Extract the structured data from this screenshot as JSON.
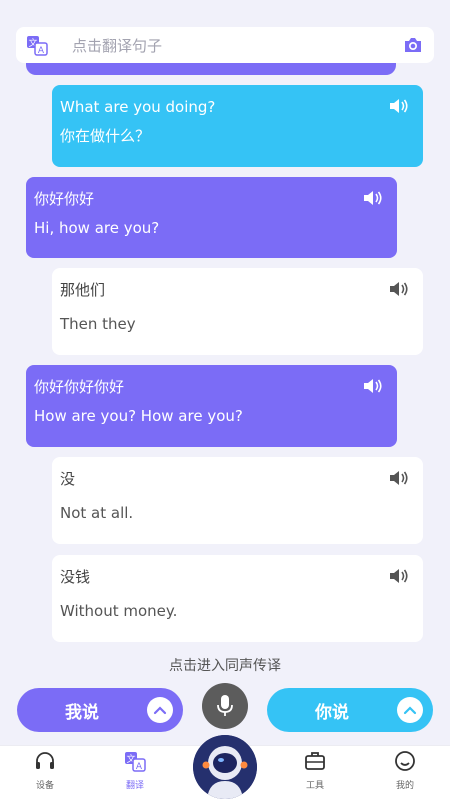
{
  "search": {
    "placeholder": "点击翻译句子"
  },
  "messages": [
    {
      "style": "cyan",
      "line1": "What are you doing?",
      "line2": "你在做什么？"
    },
    {
      "style": "purple",
      "line1": "你好你好",
      "line2": "Hi, how are you?"
    },
    {
      "style": "white",
      "line1": "那他们",
      "line2": "Then they"
    },
    {
      "style": "purple",
      "line1": "你好你好你好",
      "line2": "How are you? How are you?"
    },
    {
      "style": "white",
      "line1": "没",
      "line2": "Not at all."
    },
    {
      "style": "white",
      "line1": "没钱",
      "line2": "Without money."
    }
  ],
  "tip": "点击进入同声传译",
  "controls": {
    "me_label": "我说",
    "you_label": "你说"
  },
  "nav": {
    "items": [
      {
        "label": "设备",
        "icon": "headphones-icon"
      },
      {
        "label": "翻译",
        "icon": "translate-icon",
        "active": true
      },
      {
        "label": "工具",
        "icon": "toolbox-icon"
      },
      {
        "label": "我的",
        "icon": "smiley-icon"
      }
    ]
  },
  "colors": {
    "purple": "#7b6cf6",
    "cyan": "#35c3f5",
    "background": "#f1f1fa"
  }
}
